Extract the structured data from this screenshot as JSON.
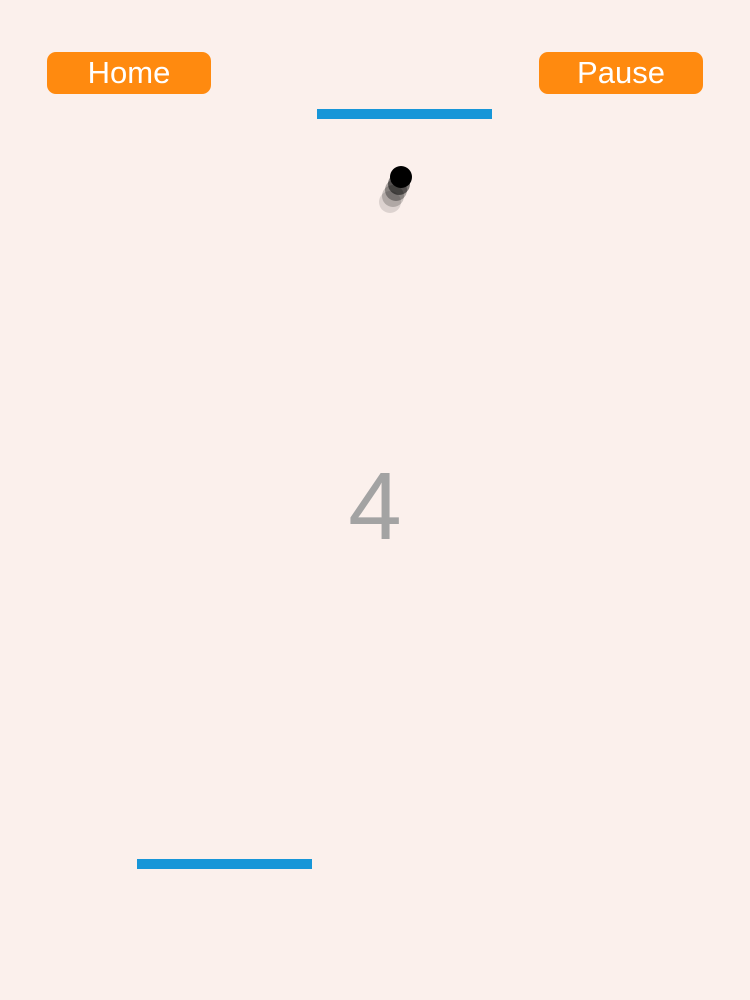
{
  "buttons": {
    "home_label": "Home",
    "pause_label": "Pause"
  },
  "score": "4",
  "colors": {
    "background": "#fbf0ec",
    "button": "#ff8a0f",
    "paddle": "#1796d8",
    "ball": "#000000",
    "score": "#a3a3a3"
  }
}
